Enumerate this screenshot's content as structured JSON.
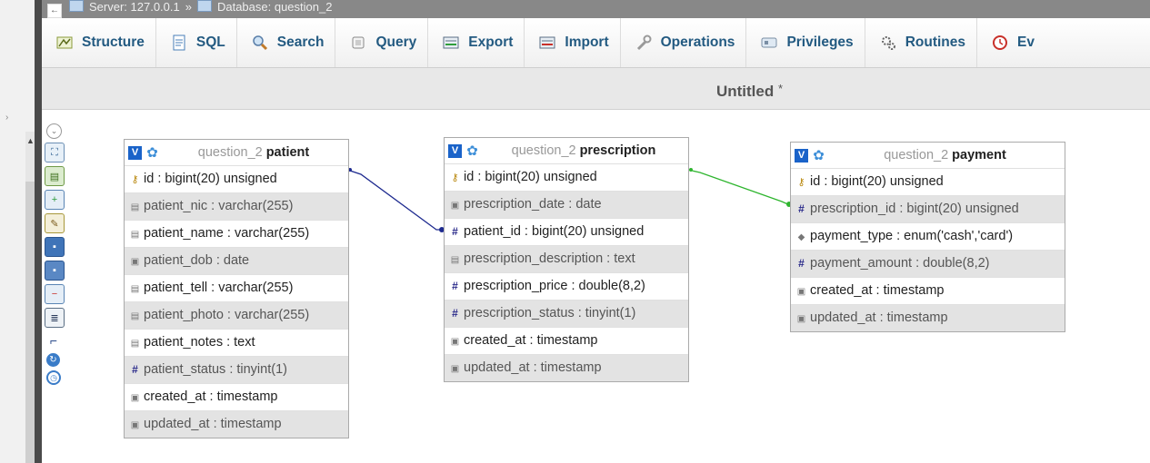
{
  "breadcrumb": {
    "server": "Server: 127.0.0.1",
    "sep": "»",
    "database": "Database: question_2"
  },
  "tabs": [
    {
      "label": "Structure",
      "icon": "structure-icon"
    },
    {
      "label": "SQL",
      "icon": "sql-icon"
    },
    {
      "label": "Search",
      "icon": "search-icon"
    },
    {
      "label": "Query",
      "icon": "query-icon"
    },
    {
      "label": "Export",
      "icon": "export-icon"
    },
    {
      "label": "Import",
      "icon": "import-icon"
    },
    {
      "label": "Operations",
      "icon": "wrench-icon"
    },
    {
      "label": "Privileges",
      "icon": "privileges-icon"
    },
    {
      "label": "Routines",
      "icon": "routines-icon"
    },
    {
      "label": "Ev",
      "icon": "events-icon"
    }
  ],
  "designer": {
    "title": "Untitled",
    "title_mark": "*"
  },
  "toolbar_icons": [
    "collapse-icon",
    "fullscreen-icon",
    "add-tables-icon",
    "new-page-icon",
    "edit-page-icon",
    "save-page-icon",
    "save-as-icon",
    "delete-page-icon",
    "export-schema-icon",
    "relation-line-icon",
    "reload-icon",
    "help-icon"
  ],
  "tables": {
    "patient": {
      "db": "question_2",
      "name": "patient",
      "columns": [
        {
          "text": "id : bigint(20) unsigned",
          "type": "key"
        },
        {
          "text": "patient_nic : varchar(255)",
          "type": "text"
        },
        {
          "text": "patient_name : varchar(255)",
          "type": "text"
        },
        {
          "text": "patient_dob : date",
          "type": "date"
        },
        {
          "text": "patient_tell : varchar(255)",
          "type": "text"
        },
        {
          "text": "patient_photo : varchar(255)",
          "type": "text"
        },
        {
          "text": "patient_notes : text",
          "type": "text"
        },
        {
          "text": "patient_status : tinyint(1)",
          "type": "num"
        },
        {
          "text": "created_at : timestamp",
          "type": "date"
        },
        {
          "text": "updated_at : timestamp",
          "type": "date"
        }
      ]
    },
    "prescription": {
      "db": "question_2",
      "name": "prescription",
      "columns": [
        {
          "text": "id : bigint(20) unsigned",
          "type": "key"
        },
        {
          "text": "prescription_date : date",
          "type": "date"
        },
        {
          "text": "patient_id : bigint(20) unsigned",
          "type": "num"
        },
        {
          "text": "prescription_description : text",
          "type": "text"
        },
        {
          "text": "prescription_price : double(8,2)",
          "type": "num"
        },
        {
          "text": "prescription_status : tinyint(1)",
          "type": "num"
        },
        {
          "text": "created_at : timestamp",
          "type": "date"
        },
        {
          "text": "updated_at : timestamp",
          "type": "date"
        }
      ]
    },
    "payment": {
      "db": "question_2",
      "name": "payment",
      "columns": [
        {
          "text": "id : bigint(20) unsigned",
          "type": "key"
        },
        {
          "text": "prescription_id : bigint(20) unsigned",
          "type": "num"
        },
        {
          "text": "payment_type : enum('cash','card')",
          "type": "enum"
        },
        {
          "text": "payment_amount : double(8,2)",
          "type": "num"
        },
        {
          "text": "created_at : timestamp",
          "type": "date"
        },
        {
          "text": "updated_at : timestamp",
          "type": "date"
        }
      ]
    }
  },
  "colors": {
    "relation_patient": "#1d2a8f",
    "relation_payment": "#2fb52f",
    "tab_text": "#235a81"
  }
}
